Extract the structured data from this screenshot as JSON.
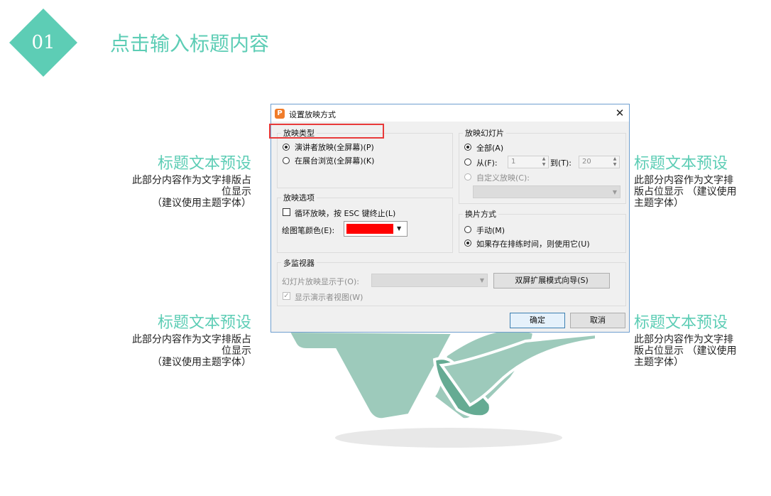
{
  "header": {
    "badge": "01",
    "title": "点击输入标题内容"
  },
  "blocks": {
    "left_top": {
      "title": "标题文本预设",
      "line1": "此部分内容作为文字排版占",
      "line2": "位显示",
      "line3": "（建议使用主题字体）"
    },
    "left_bottom": {
      "title": "标题文本预设",
      "line1": "此部分内容作为文字排版占",
      "line2": "位显示",
      "line3": "（建议使用主题字体）"
    },
    "right_top": {
      "title": "标题文本预设",
      "line1": "此部分内容作为文字排",
      "line2": "版占位显示 （建议使用",
      "line3": "主题字体）"
    },
    "right_bottom": {
      "title": "标题文本预设",
      "line1": "此部分内容作为文字排",
      "line2": "版占位显示 （建议使用",
      "line3": "主题字体）"
    }
  },
  "dialog": {
    "title": "设置放映方式",
    "close": "✕",
    "app_icon": "P",
    "show_type": {
      "label": "放映类型",
      "opt_speaker": "演讲者放映(全屏幕)(P)",
      "opt_kiosk": "在展台浏览(全屏幕)(K)"
    },
    "show_options": {
      "label": "放映选项",
      "loop": "循环放映，按 ESC 键终止(L)",
      "pen_color_label": "绘图笔颜色(E):",
      "pen_color": "#ff0000"
    },
    "slides": {
      "label": "放映幻灯片",
      "all": "全部(A)",
      "from": "从(F):",
      "from_value": "1",
      "to": "到(T):",
      "to_value": "20",
      "custom": "自定义放映(C):"
    },
    "advance": {
      "label": "换片方式",
      "manual": "手动(M)",
      "timings": "如果存在排练时间，则使用它(U)"
    },
    "monitors": {
      "label": "多监视器",
      "display_on": "幻灯片放映显示于(O):",
      "dual_wizard": "双屏扩展模式向导(S)",
      "presenter_view": "显示演示者视图(W)"
    },
    "ok": "确定",
    "cancel": "取消"
  },
  "colors": {
    "accent": "#5dcdb5",
    "deco_light": "#9dcabb",
    "deco_dark": "#65ab93",
    "highlight": "#e83a3a"
  }
}
